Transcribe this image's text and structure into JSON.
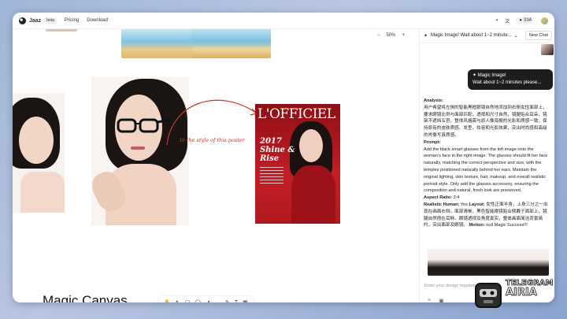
{
  "topbar": {
    "brand": "Jaaz",
    "beta": "beta",
    "nav": [
      "Pricing",
      "Download"
    ],
    "credits": "334"
  },
  "canvas": {
    "zoom": "50%",
    "zoom_minus": "−",
    "zoom_plus": "+",
    "annotation": "In the style of this poster",
    "label": "Magic Canvas",
    "tools": [
      "✋",
      "↖",
      "▢",
      "◯",
      "↗",
      "—",
      "✎",
      "T",
      "▦"
    ]
  },
  "poster": {
    "title": "L'OFFICIEL",
    "year": "2017",
    "line1": "Shine &",
    "line2": "Rise"
  },
  "panel": {
    "header": "Magic Image! Wait about 1~2 minute...",
    "new_chat": "New Chat",
    "bubble_line1": "✦ Magic Image!",
    "bubble_line2": "Wait about 1~2 minutes please...",
    "analysis_label": "Analysis:",
    "analysis": "用户希望将左侧的智能黑框眼镜自然地添加到右侧女性面部上，要求眼镜比例与面部匹配，透视和尺寸自然，镜腿贴合耳朵，镜架不遮挡五官。整体风格需与原人像海报的光影和质感一致，保持原有的皮肤质感、发型、妆容和光影效果，突出时尚感和高级的肖像写真质感。",
    "prompt_label": "Prompt:",
    "prompt": "Add the black smart glasses from the left image onto the woman's face in the right image. The glasses should fit her face naturally, matching the correct perspective and size, with the temples positioned naturally behind her ears. Maintain the original lighting, skin texture, hair, makeup, and overall realistic portrait style. Only add the glasses accessory, ensuring the composition and natural, fresh look are preserved.",
    "aspect_label": "Aspect Ratio:",
    "aspect": "3:4",
    "realistic_label": "Realistic Human:",
    "realistic": "Yes",
    "layout_label": "Layout:",
    "layout": "女性正面半身，上身三分之一出现在画面右侧。面部清晰，黑色智能眼镜贴合佩戴于面部上，镜腿自然搭在耳畔。眼镜透视及角度真实，整体画面简洁背景简约，突出面部及眼镜。",
    "motion_label": "Motion:",
    "motion": "null",
    "success": "Magic Success!!!",
    "input_placeholder": "Enter your design requirements"
  },
  "badge": {
    "line1": "TELEGRAM",
    "line2": "AIRIA"
  }
}
